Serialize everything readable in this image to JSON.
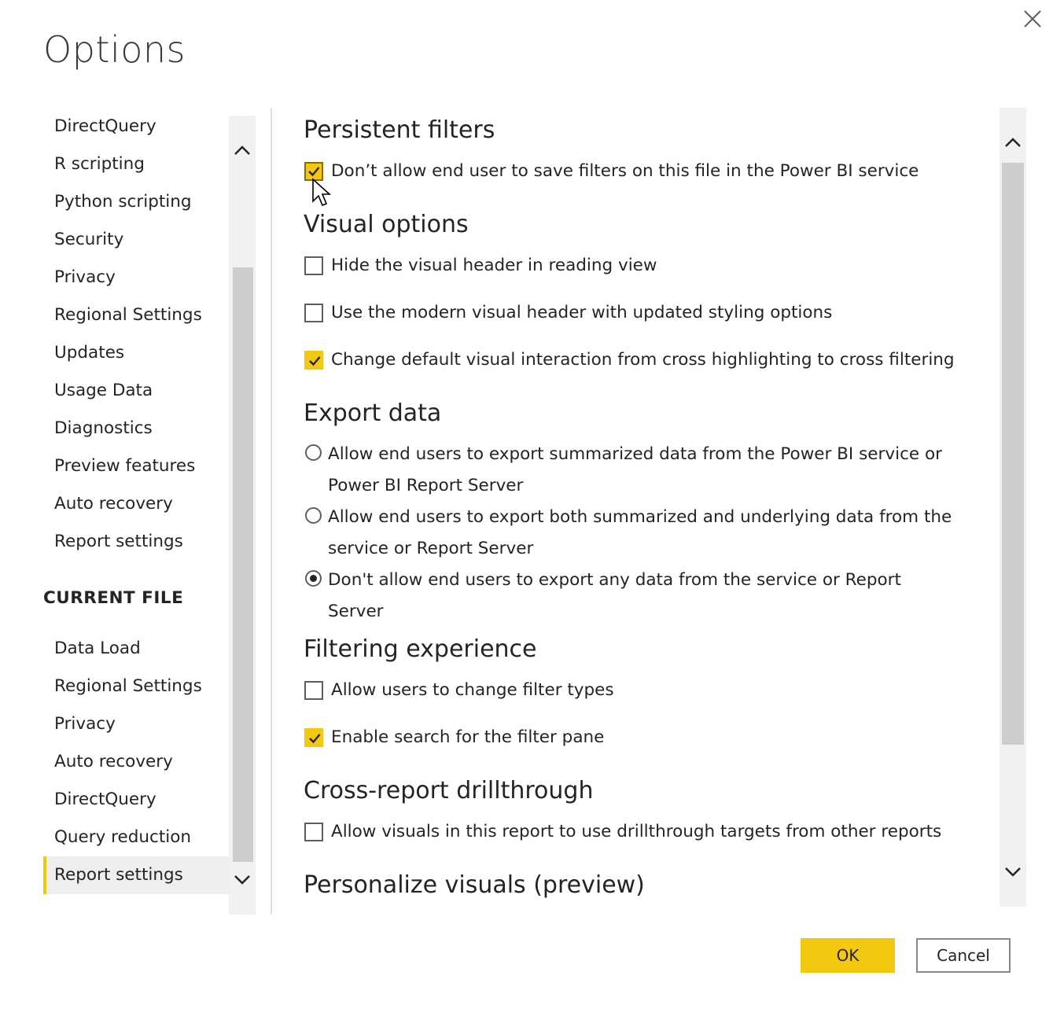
{
  "dialog": {
    "title": "Options"
  },
  "sidebar": {
    "global_items": [
      {
        "label": "DirectQuery"
      },
      {
        "label": "R scripting"
      },
      {
        "label": "Python scripting"
      },
      {
        "label": "Security"
      },
      {
        "label": "Privacy"
      },
      {
        "label": "Regional Settings"
      },
      {
        "label": "Updates"
      },
      {
        "label": "Usage Data"
      },
      {
        "label": "Diagnostics"
      },
      {
        "label": "Preview features"
      },
      {
        "label": "Auto recovery"
      },
      {
        "label": "Report settings"
      }
    ],
    "current_file_heading": "CURRENT FILE",
    "current_file_items": [
      {
        "label": "Data Load"
      },
      {
        "label": "Regional Settings"
      },
      {
        "label": "Privacy"
      },
      {
        "label": "Auto recovery"
      },
      {
        "label": "DirectQuery"
      },
      {
        "label": "Query reduction"
      },
      {
        "label": "Report settings",
        "selected": true
      }
    ]
  },
  "sections": {
    "persistent_filters": {
      "title": "Persistent filters",
      "options": [
        {
          "label": "Don’t allow end user to save filters on this file in the Power BI service",
          "checked": true
        }
      ]
    },
    "visual_options": {
      "title": "Visual options",
      "options": [
        {
          "label": "Hide the visual header in reading view",
          "checked": false
        },
        {
          "label": "Use the modern visual header with updated styling options",
          "checked": false
        },
        {
          "label": "Change default visual interaction from cross highlighting to cross filtering",
          "checked": true
        }
      ]
    },
    "export_data": {
      "title": "Export data",
      "options": [
        {
          "line1": "Allow end users to export summarized data from the Power BI service or",
          "line2": "Power BI Report Server",
          "selected": false
        },
        {
          "line1": "Allow end users to export both summarized and underlying data from the",
          "line2": "service or Report Server",
          "selected": false
        },
        {
          "line1": "Don't allow end users to export any data from the service or Report",
          "line2": "Server",
          "selected": true
        }
      ]
    },
    "filtering_experience": {
      "title": "Filtering experience",
      "options": [
        {
          "label": "Allow users to change filter types",
          "checked": false
        },
        {
          "label": "Enable search for the filter pane",
          "checked": true
        }
      ]
    },
    "cross_report": {
      "title": "Cross-report drillthrough",
      "options": [
        {
          "label": "Allow visuals in this report to use drillthrough targets from other reports",
          "checked": false
        }
      ]
    },
    "personalize_visuals": {
      "title": "Personalize visuals (preview)"
    }
  },
  "buttons": {
    "ok": "OK",
    "cancel": "Cancel"
  },
  "colors": {
    "accent": "#f2c811",
    "text": "#252423",
    "scrollbar_track": "#f1f1f1",
    "scrollbar_thumb": "#cdcdcd"
  },
  "icons": {
    "close": "close-icon",
    "scroll_up": "chevron-up-icon",
    "scroll_down": "chevron-down-icon",
    "check": "checkmark-icon",
    "cursor": "mouse-pointer-icon"
  }
}
